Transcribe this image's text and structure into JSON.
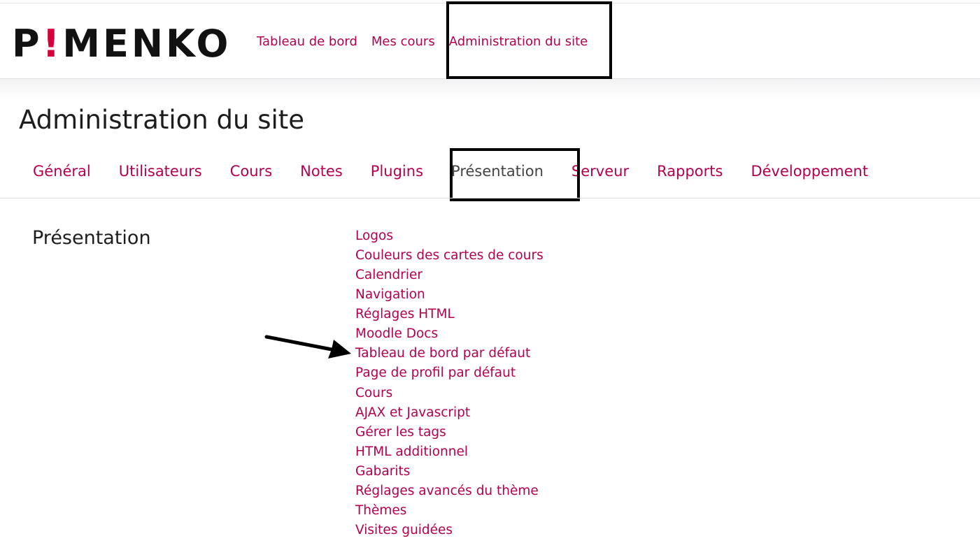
{
  "brand": {
    "logo_text_1": "P",
    "logo_bang": "!",
    "logo_text_2": "MENKO",
    "accent_color": "#d6003a",
    "link_color": "#b5004f"
  },
  "primary_nav": {
    "items": [
      {
        "label": "Tableau de bord"
      },
      {
        "label": "Mes cours"
      },
      {
        "label": "Administration du site",
        "highlighted": true
      }
    ]
  },
  "page": {
    "title": "Administration du site"
  },
  "secondary_nav": {
    "tabs": [
      {
        "label": "Général"
      },
      {
        "label": "Utilisateurs"
      },
      {
        "label": "Cours"
      },
      {
        "label": "Notes"
      },
      {
        "label": "Plugins"
      },
      {
        "label": "Présentation",
        "active": true,
        "highlighted": true
      },
      {
        "label": "Serveur"
      },
      {
        "label": "Rapports"
      },
      {
        "label": "Développement"
      }
    ]
  },
  "section": {
    "heading": "Présentation",
    "links": [
      "Logos",
      "Couleurs des cartes de cours",
      "Calendrier",
      "Navigation",
      "Réglages HTML",
      "Moodle Docs",
      "Tableau de bord par défaut",
      "Page de profil par défaut",
      "Cours",
      "AJAX et Javascript",
      "Gérer les tags",
      "HTML additionnel",
      "Gabarits",
      "Réglages avancés du thème",
      "Thèmes",
      "Visites guidées"
    ],
    "arrow_target": "Tableau de bord par défaut"
  }
}
